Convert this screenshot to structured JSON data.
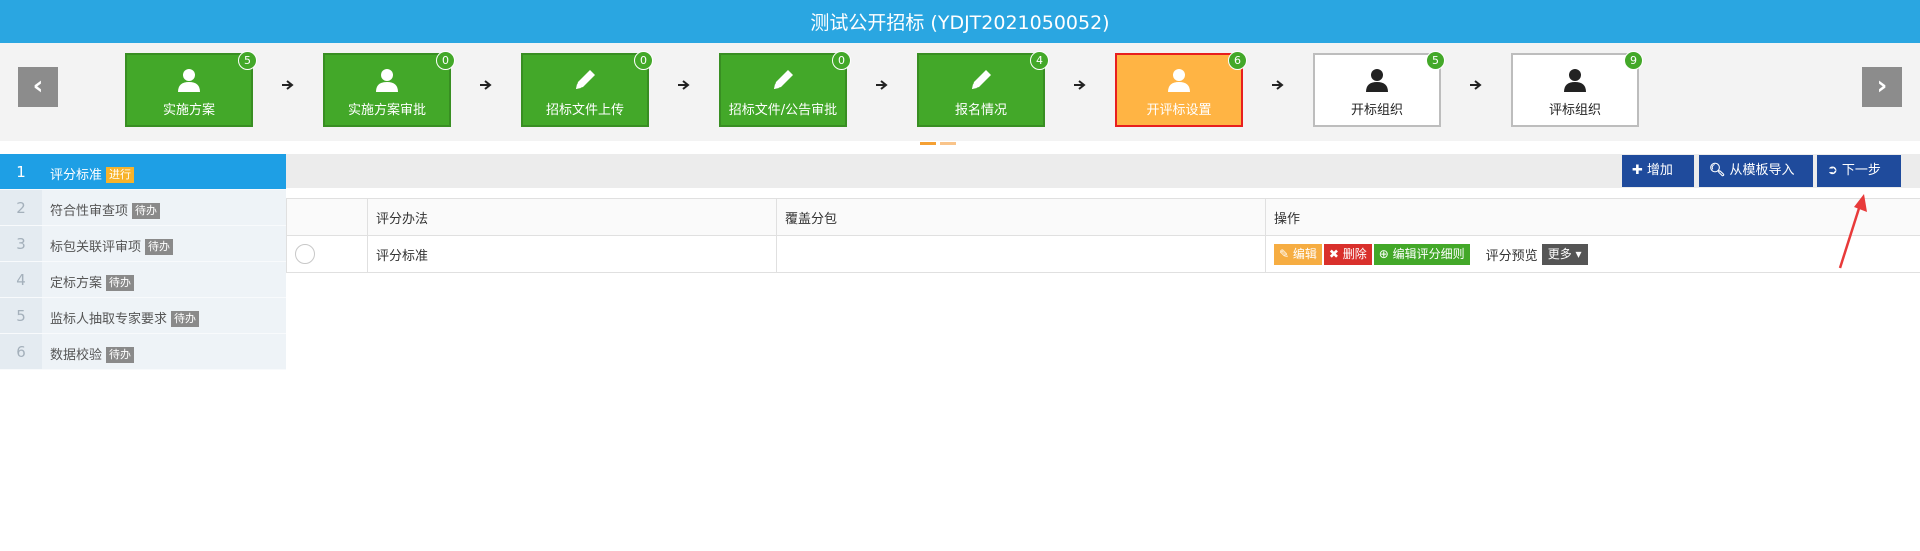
{
  "header": {
    "title": "测试公开招标 (YDJT2021050052)"
  },
  "steps": [
    {
      "label": "实施方案",
      "count": "5",
      "icon": "user-icon",
      "state": "done"
    },
    {
      "label": "实施方案审批",
      "count": "0",
      "icon": "user-icon",
      "state": "done"
    },
    {
      "label": "招标文件上传",
      "count": "0",
      "icon": "pencil-icon",
      "state": "done"
    },
    {
      "label": "招标文件/公告审批",
      "count": "0",
      "icon": "pencil-icon",
      "state": "done"
    },
    {
      "label": "报名情况",
      "count": "4",
      "icon": "pencil-icon",
      "state": "done"
    },
    {
      "label": "开评标设置",
      "count": "6",
      "icon": "user-icon",
      "state": "current"
    },
    {
      "label": "开标组织",
      "count": "5",
      "icon": "user-icon",
      "state": "pending"
    },
    {
      "label": "评标组织",
      "count": "9",
      "icon": "user-icon",
      "state": "pending"
    }
  ],
  "sidebar": {
    "items": [
      {
        "num": "1",
        "label": "评分标准",
        "tag": "进行",
        "active": true
      },
      {
        "num": "2",
        "label": "符合性审查项",
        "tag": "待办"
      },
      {
        "num": "3",
        "label": "标包关联评审项",
        "tag": "待办"
      },
      {
        "num": "4",
        "label": "定标方案",
        "tag": "待办"
      },
      {
        "num": "5",
        "label": "监标人抽取专家要求",
        "tag": "待办"
      },
      {
        "num": "6",
        "label": "数据校验",
        "tag": "待办"
      }
    ]
  },
  "toolbar": {
    "add_label": "增加",
    "import_label": "从模板导入",
    "next_label": "下一步"
  },
  "table": {
    "columns": [
      "",
      "评分办法",
      "覆盖分包",
      "操作"
    ],
    "rows": [
      {
        "method": "评分标准",
        "packages": ""
      }
    ],
    "actions": {
      "edit": "编辑",
      "delete": "删除",
      "detail": "编辑评分细则",
      "preview": "评分预览",
      "more": "更多"
    }
  },
  "colors": {
    "header": "#2aa6e1",
    "done": "#43a829",
    "current": "#ffb444",
    "primary": "#1f4b9c",
    "annotation": "#e83a3a"
  }
}
